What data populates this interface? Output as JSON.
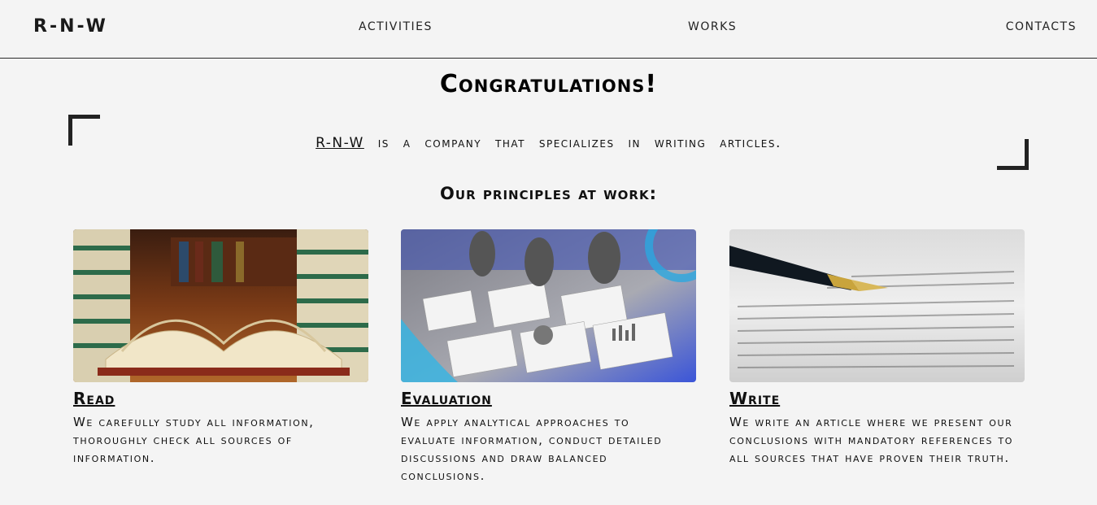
{
  "header": {
    "logo": "R-N-W",
    "nav": [
      "ACTIVITIES",
      "WORKS",
      "CONTACTS"
    ]
  },
  "main": {
    "title": "Congratulations!",
    "intro_brand": "R-N-W",
    "intro_text": " is a company that specializes in writing articles.",
    "subtitle": "Our principles at work:"
  },
  "cards": [
    {
      "title": "Read",
      "text": "We carefully study all information, thoroughly check all sources of information.",
      "image": "books-photo"
    },
    {
      "title": "Evaluation",
      "text": "We apply analytical approaches to evaluate information, conduct detailed discussions and draw balanced conclusions.",
      "image": "analytics-meeting-photo"
    },
    {
      "title": "Write",
      "text": "We write an article where we present our conclusions with mandatory references to all sources that have proven their truth.",
      "image": "fountain-pen-photo"
    }
  ],
  "colors": {
    "background": "#f4f4f4",
    "text": "#111111",
    "accent_blue": "#3b5bdb"
  }
}
